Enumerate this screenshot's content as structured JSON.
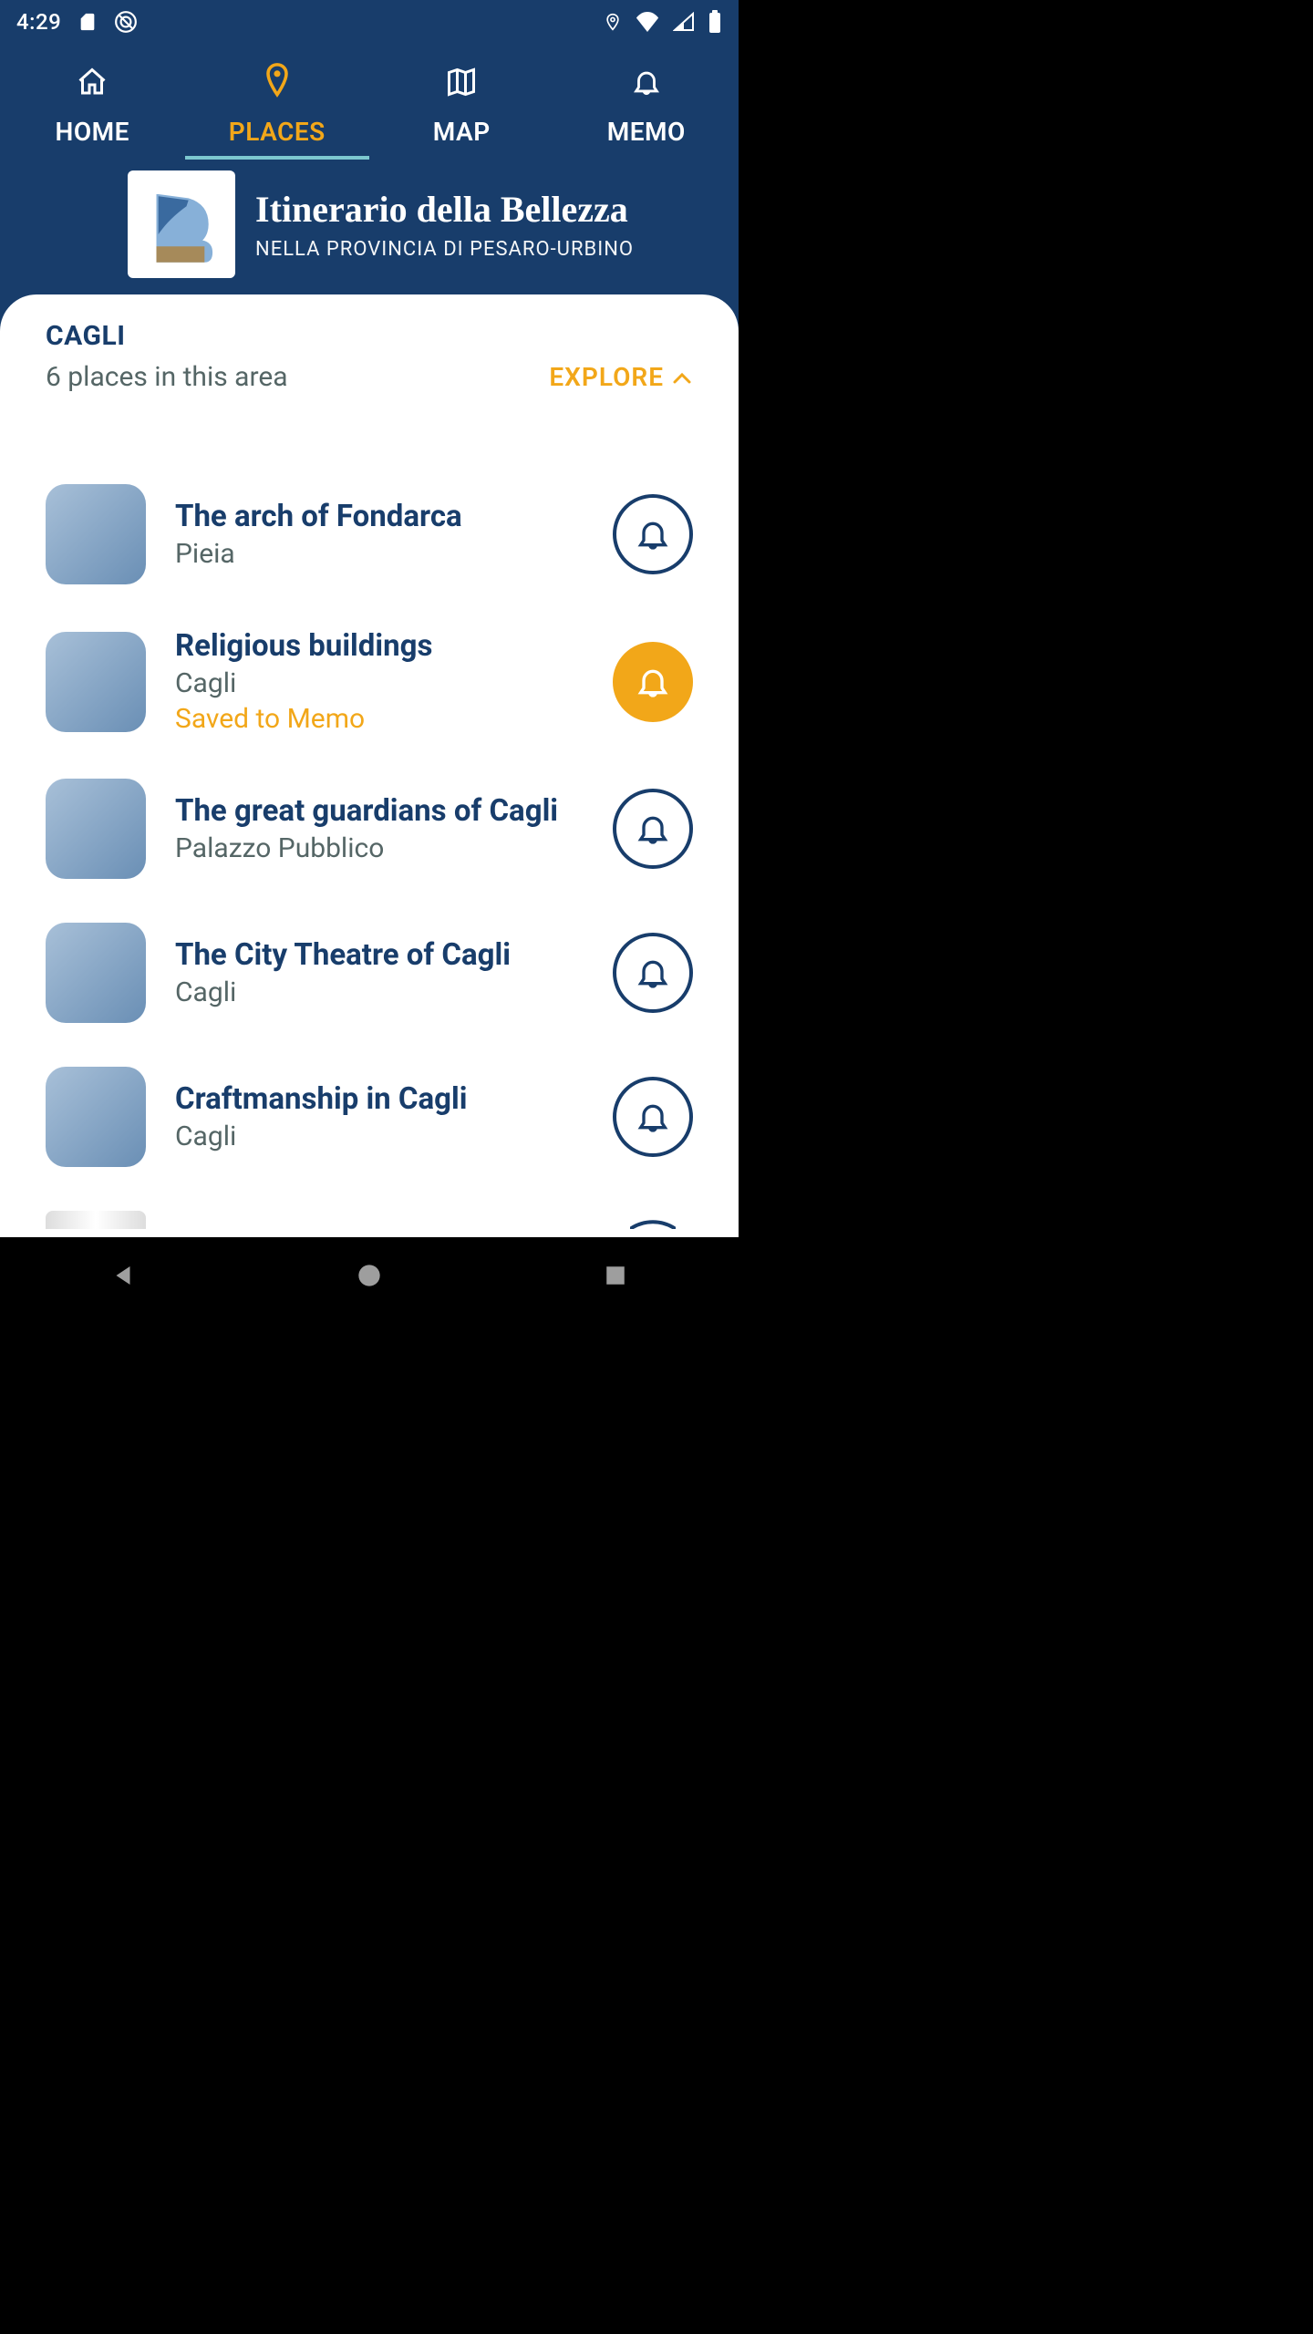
{
  "status": {
    "time": "4:29"
  },
  "tabs": {
    "home": "HOME",
    "places": "PLACES",
    "map": "MAP",
    "memo": "MEMO"
  },
  "brand": {
    "title": "Itinerario della Bellezza",
    "subtitle": "NELLA PROVINCIA DI PESARO-URBINO"
  },
  "area": {
    "name": "CAGLI",
    "count_label": "6 places in this area",
    "explore_label": "EXPLORE"
  },
  "places": [
    {
      "title": "The arch of Fondarca",
      "subtitle": "Pieia",
      "saved_label": "",
      "saved": false
    },
    {
      "title": "Religious buildings",
      "subtitle": "Cagli",
      "saved_label": "Saved to Memo",
      "saved": true
    },
    {
      "title": "The great guardians of Cagli",
      "subtitle": "Palazzo Pubblico",
      "saved_label": "",
      "saved": false
    },
    {
      "title": "The City Theatre of Cagli",
      "subtitle": "Cagli",
      "saved_label": "",
      "saved": false
    },
    {
      "title": "Craftmanship in Cagli",
      "subtitle": "Cagli",
      "saved_label": "",
      "saved": false
    }
  ],
  "colors": {
    "accent": "#f2a719",
    "primary": "#183d6b"
  }
}
